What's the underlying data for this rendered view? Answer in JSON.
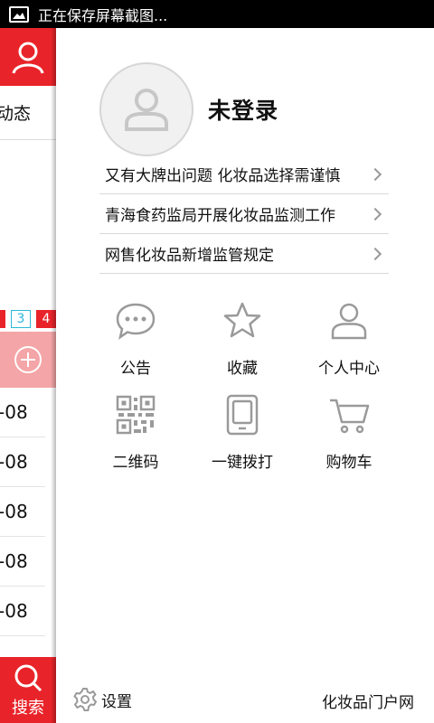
{
  "status_bar": {
    "text": "正在保存屏幕截图..."
  },
  "background_page": {
    "tab_label": "动态",
    "pages": [
      "3",
      "4"
    ],
    "rows": [
      "-08",
      "-08",
      "-08",
      "-08",
      "-08"
    ],
    "search_label": "搜索"
  },
  "drawer": {
    "username": "未登录",
    "news": [
      "又有大牌出问题 化妆品选择需谨慎",
      "青海食药监局开展化妆品监测工作",
      "网售化妆品新增监管规定"
    ],
    "grid": [
      {
        "label": "公告",
        "icon": "chat-bubble-icon"
      },
      {
        "label": "收藏",
        "icon": "star-icon"
      },
      {
        "label": "个人中心",
        "icon": "person-icon"
      },
      {
        "label": "二维码",
        "icon": "qr-code-icon"
      },
      {
        "label": "一键拨打",
        "icon": "phone-icon"
      },
      {
        "label": "购物车",
        "icon": "cart-icon"
      }
    ],
    "footer": {
      "settings_label": "设置",
      "portal_label": "化妆品门户网"
    }
  },
  "colors": {
    "accent": "#e8242a",
    "icon_gray": "#9a9a9a",
    "divider": "#d9d9d9"
  }
}
